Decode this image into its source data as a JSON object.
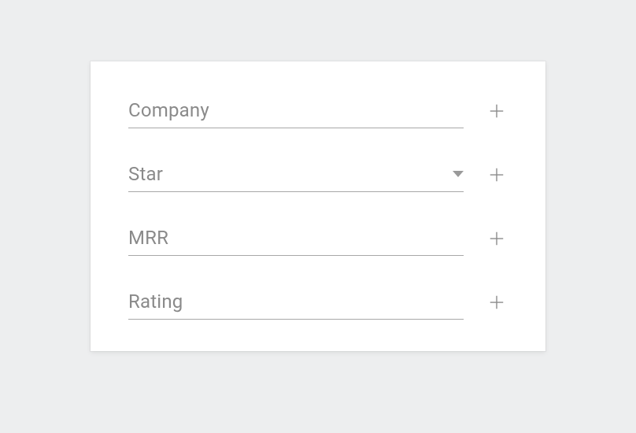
{
  "fields": [
    {
      "label": "Company",
      "type": "text"
    },
    {
      "label": "Star",
      "type": "select"
    },
    {
      "label": "MRR",
      "type": "text"
    },
    {
      "label": "Rating",
      "type": "text"
    }
  ]
}
